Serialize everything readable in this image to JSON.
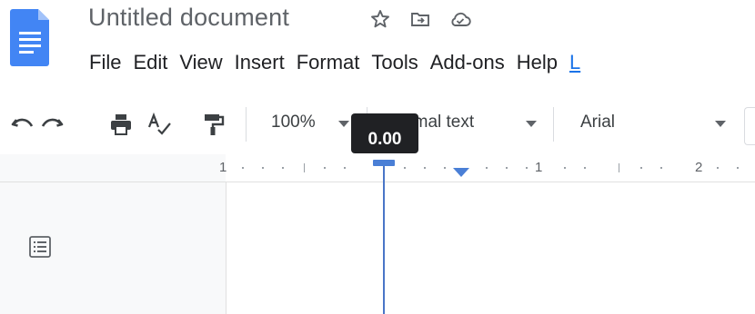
{
  "header": {
    "title": "Untitled document",
    "icons": [
      "star-icon",
      "move-to-folder-icon",
      "cloud-status-icon"
    ]
  },
  "menubar": {
    "items": [
      "File",
      "Edit",
      "View",
      "Insert",
      "Format",
      "Tools",
      "Add-ons",
      "Help",
      "L"
    ]
  },
  "toolbar": {
    "zoom": "100%",
    "style": "Normal text",
    "font": "Arial"
  },
  "ruler": {
    "left_margin_label": "1",
    "label_1": "1",
    "label_2": "2"
  },
  "tooltip": {
    "value": "0.00"
  },
  "colors": {
    "accent": "#4285f4",
    "indent_marker": "#4a7fd6",
    "tooltip_bg": "#202124"
  }
}
